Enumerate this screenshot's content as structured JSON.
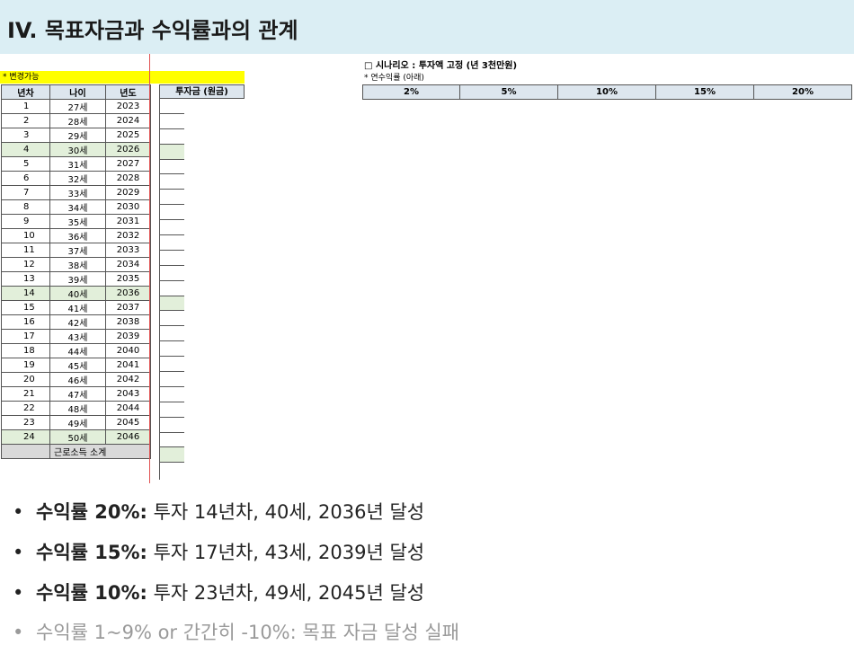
{
  "title": "IV. 목표자금과 수익률과의 관계",
  "left_table": {
    "editable_note": "* 변경가능",
    "headers": {
      "year_no": "년차",
      "age": "나이",
      "year": "년도",
      "investment": "투자금 (원금)"
    },
    "rows": [
      {
        "n": "1",
        "age": "27세",
        "year": "2023"
      },
      {
        "n": "2",
        "age": "28세",
        "year": "2024"
      },
      {
        "n": "3",
        "age": "29세",
        "year": "2025"
      },
      {
        "n": "4",
        "age": "30세",
        "year": "2026"
      },
      {
        "n": "5",
        "age": "31세",
        "year": "2027"
      },
      {
        "n": "6",
        "age": "32세",
        "year": "2028"
      },
      {
        "n": "7",
        "age": "33세",
        "year": "2029"
      },
      {
        "n": "8",
        "age": "34세",
        "year": "2030"
      },
      {
        "n": "9",
        "age": "35세",
        "year": "2031"
      },
      {
        "n": "10",
        "age": "36세",
        "year": "2032"
      },
      {
        "n": "11",
        "age": "37세",
        "year": "2033"
      },
      {
        "n": "12",
        "age": "38세",
        "year": "2034"
      },
      {
        "n": "13",
        "age": "39세",
        "year": "2035"
      },
      {
        "n": "14",
        "age": "40세",
        "year": "2036"
      },
      {
        "n": "15",
        "age": "41세",
        "year": "2037"
      },
      {
        "n": "16",
        "age": "42세",
        "year": "2038"
      },
      {
        "n": "17",
        "age": "43세",
        "year": "2039"
      },
      {
        "n": "18",
        "age": "44세",
        "year": "2040"
      },
      {
        "n": "19",
        "age": "45세",
        "year": "2041"
      },
      {
        "n": "20",
        "age": "46세",
        "year": "2042"
      },
      {
        "n": "21",
        "age": "47세",
        "year": "2043"
      },
      {
        "n": "22",
        "age": "48세",
        "year": "2044"
      },
      {
        "n": "23",
        "age": "49세",
        "year": "2045"
      },
      {
        "n": "24",
        "age": "50세",
        "year": "2046"
      }
    ],
    "highlighted_rows": [
      "4",
      "14",
      "24"
    ],
    "total_label": "근로소득 소계"
  },
  "scenario": {
    "title": "□ 시나리오 : 투자액 고정 (년 3천만원)",
    "rate_note": "* 연수익률 (아래)",
    "rates": [
      "2%",
      "5%",
      "10%",
      "15%",
      "20%"
    ]
  },
  "bullets": [
    {
      "bold": "수익률 20%:",
      "text": " 투자 14년차, 40세, 2036년 달성"
    },
    {
      "bold": "수익률 15%:",
      "text": " 투자 17년차, 43세, 2039년 달성"
    },
    {
      "bold": "수익률 10%:",
      "text": " 투자 23년차, 49세, 2045년 달성"
    },
    {
      "bold": "",
      "text": "수익률 1~9% or 간간히 -10%: 목표 자금 달성 실패"
    }
  ],
  "colors": {
    "title_bar": "#dbeef4",
    "editable": "#ffff00",
    "highlight_row": "#e2efda",
    "header_cell": "#dde6ee"
  }
}
